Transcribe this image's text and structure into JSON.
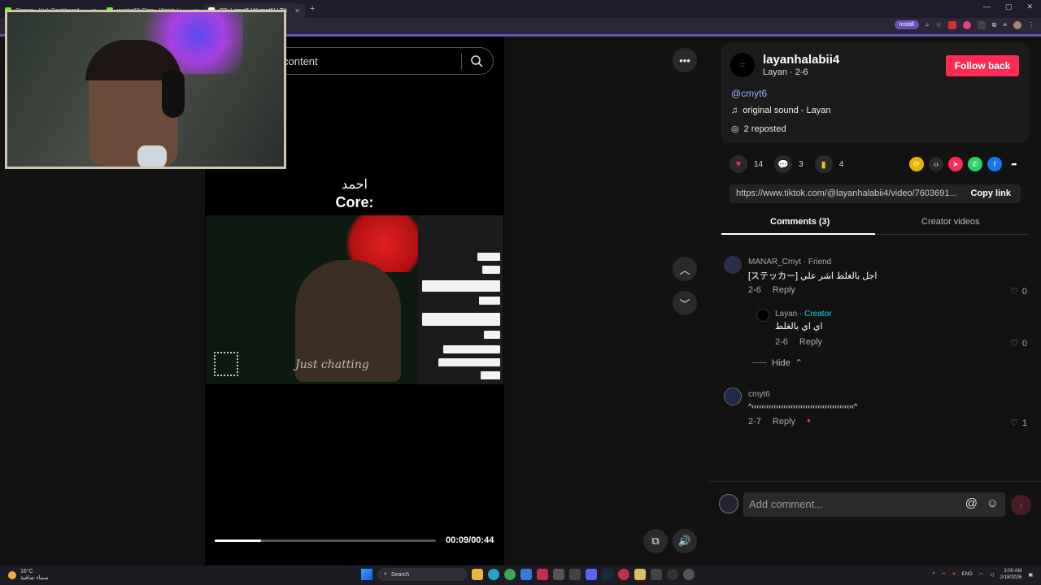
{
  "browser": {
    "tabs": [
      {
        "title": "Stream - Kick Dashboard",
        "color": "#53fc18"
      },
      {
        "title": "jaseka68 Clips - Watch Live on",
        "color": "#53fc18"
      },
      {
        "title": "(99+) cmyt6 (@cmyt6) | Tik",
        "color": "#ffffff"
      }
    ],
    "install_label": "Install"
  },
  "video": {
    "search_text": "content",
    "overlay_text_ar": "احمد",
    "overlay_text_core": "Core:",
    "inner_caption": "Just chatting",
    "time": "00:09/00:44",
    "progress": 0.21
  },
  "post": {
    "avatar_text": ":::",
    "username": "layanhalabii4",
    "subline": "Layan · 2-6",
    "follow_label": "Follow back",
    "mention": "@cmyt6",
    "sound": "original sound - Layan",
    "reposted": "2 reposted",
    "likes": "14",
    "comments_count": "3",
    "saves": "4",
    "url": "https://www.tiktok.com/@layanhalabii4/video/7603691...",
    "copy_label": "Copy link"
  },
  "tabs": {
    "comments": "Comments (3)",
    "creator": "Creator videos"
  },
  "comments": [
    {
      "name": "MANAR_Cmyt",
      "tag": " · Friend",
      "text": "[ステッカー] اجل بالغلط اشر علي",
      "date": "2-6",
      "reply": "Reply",
      "likes": "0"
    },
    {
      "name": "Layan",
      "tag": " · Creator",
      "text": "اي اي بالغلط",
      "date": "2-6",
      "reply": "Reply",
      "likes": "0"
    },
    {
      "name": "cmyt6",
      "tag": "",
      "text": "^‹‹‹‹‹‹‹‹‹‹‹‹‹‹‹‹‹‹‹‹‹‹‹‹‹‹‹‹‹‹‹‹‹‹‹‹‹‹‹‹‹‹^",
      "date": "2-7",
      "reply": "Reply",
      "likes": "1"
    }
  ],
  "hide_label": "Hide",
  "comment_placeholder": "Add comment...",
  "taskbar": {
    "temp": "16°C",
    "weather_text": "سماء صافية",
    "search": "Search",
    "lang": "ENG",
    "time": "3:00 AM",
    "date": "2/18/2026"
  },
  "colors": {
    "follow": "#fe2c55",
    "accent_purple": "#6b4fb8",
    "creator_tag": "#20d5ec"
  }
}
